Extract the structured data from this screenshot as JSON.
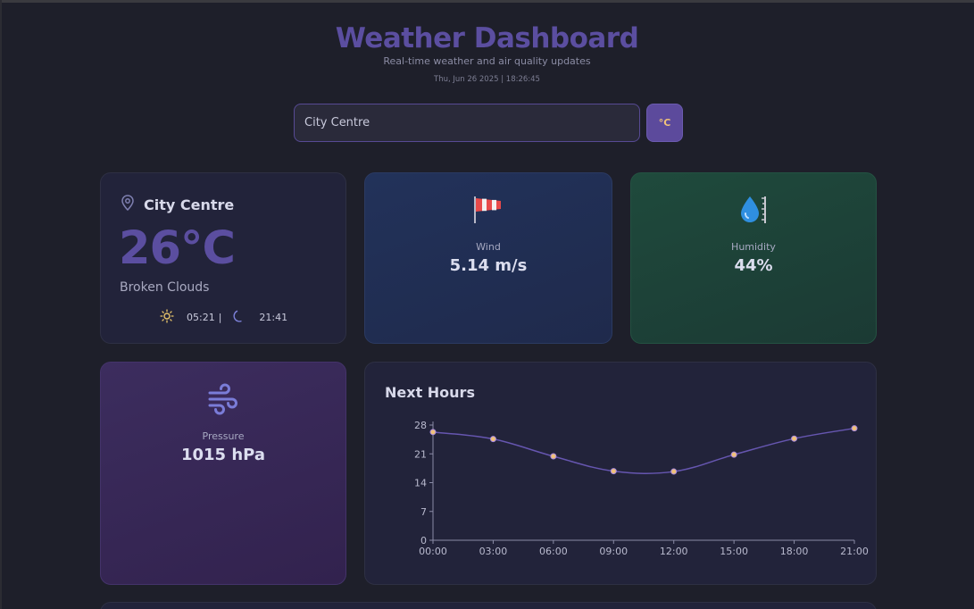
{
  "header": {
    "title": "Weather Dashboard",
    "subtitle": "Real-time weather and air quality updates",
    "datetime": "Thu, Jun 26 2025 | 18:26:45"
  },
  "search": {
    "value": "City Centre",
    "unit_label": "°C"
  },
  "location_card": {
    "name": "City Centre",
    "temperature": "26°C",
    "condition": "Broken Clouds",
    "sunrise": "05:21",
    "separator": "|",
    "sunset": "21:41",
    "icons": {
      "location": "map-pin-icon",
      "sunrise": "sun-icon",
      "sunset": "moon-icon"
    }
  },
  "wind_card": {
    "icon": "windsock-icon",
    "label": "Wind",
    "value": "5.14 m/s"
  },
  "humidity_card": {
    "icon": "droplet-icon",
    "label": "Humidity",
    "value": "44%"
  },
  "pressure_card": {
    "icon": "wind-icon",
    "label": "Pressure",
    "value": "1015 hPa"
  },
  "forecast": {
    "title": "Next Hours",
    "chart_data": {
      "type": "line",
      "x": [
        "00:00",
        "03:00",
        "06:00",
        "09:00",
        "12:00",
        "15:00",
        "18:00",
        "21:00"
      ],
      "values": [
        26.3,
        24.6,
        20.4,
        16.8,
        16.7,
        20.8,
        24.7,
        27.2
      ],
      "yticks": [
        0,
        7,
        14,
        21,
        28
      ],
      "ylim": [
        0,
        28
      ],
      "line_color": "#6656b0",
      "point_color": "#f0c27a",
      "grid": false
    }
  },
  "colors": {
    "accent": "#5b4ea0",
    "background": "#1e1f2a",
    "unit_text": "#f0c27a"
  }
}
